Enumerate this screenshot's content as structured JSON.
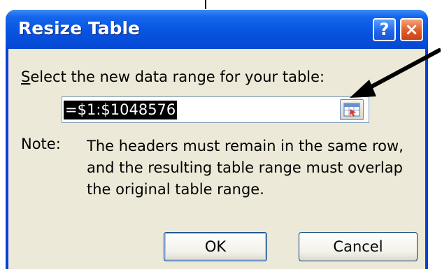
{
  "dialog": {
    "title": "Resize Table",
    "help_label": "?",
    "close_label": "×",
    "prompt_accesskey": "S",
    "prompt_rest": "elect the new data range for your table:",
    "range_value": "=$1:$1048576",
    "note_label": "Note:",
    "note_lines": [
      "The headers must remain in the same row,",
      "and the resulting table range must overlap",
      "the original table range."
    ],
    "ok_label": "OK",
    "cancel_label": "Cancel"
  },
  "icons": {
    "collapse": "range-selector-icon",
    "annotation": "arrow-annotation"
  },
  "colors": {
    "titlebar": "#0754e0",
    "client": "#ece9d8",
    "close": "#e05a2c",
    "selection": "#000000"
  }
}
